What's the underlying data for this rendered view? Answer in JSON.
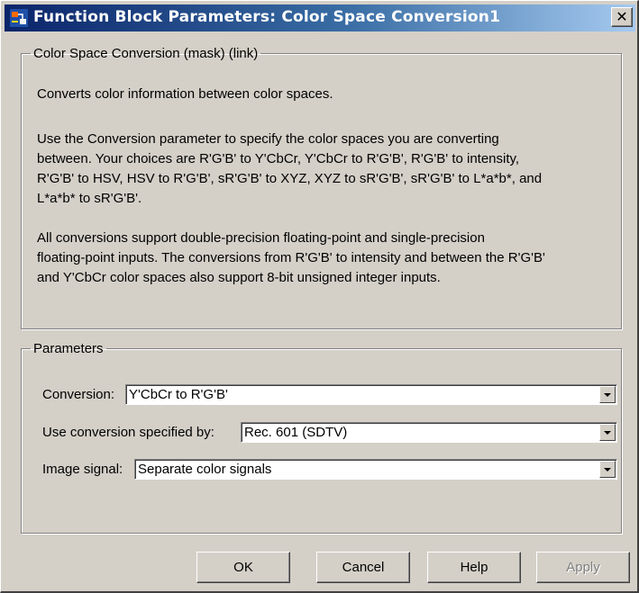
{
  "window": {
    "title": "Function Block Parameters: Color Space  Conversion1",
    "close_symbol": "✕",
    "icon": "simulink-block-icon",
    "titlebar_colors": [
      "#0a246a",
      "#a6caf0"
    ]
  },
  "description": {
    "legend": "Color Space Conversion (mask) (link)",
    "paragraphs": [
      "Converts color information between color spaces.",
      "Use the Conversion parameter to specify the color spaces you are converting\nbetween. Your choices are R'G'B' to Y'CbCr, Y'CbCr to R'G'B', R'G'B' to intensity,\nR'G'B' to HSV, HSV to R'G'B', sR'G'B' to XYZ, XYZ to sR'G'B', sR'G'B' to L*a*b*, and\nL*a*b* to sR'G'B'.",
      "All conversions support double-precision floating-point and single-precision\nfloating-point inputs. The conversions from R'G'B' to intensity and between the R'G'B'\nand Y'CbCr color spaces also support 8-bit unsigned integer inputs."
    ]
  },
  "parameters": {
    "legend": "Parameters",
    "conversion": {
      "label": "Conversion:",
      "value": "Y'CbCr to R'G'B'"
    },
    "use_conversion": {
      "label": "Use conversion specified by:",
      "value": "Rec. 601 (SDTV)"
    },
    "image_signal": {
      "label": "Image signal:",
      "value": "Separate color signals"
    }
  },
  "buttons": {
    "ok": "OK",
    "cancel": "Cancel",
    "help": "Help",
    "apply": "Apply"
  }
}
